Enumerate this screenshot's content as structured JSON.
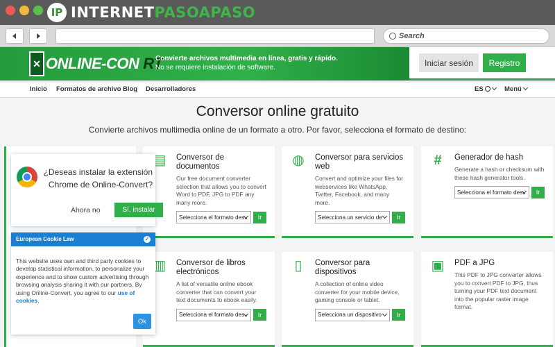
{
  "browser": {
    "brand_prefix": "INTERNET",
    "brand_accent": "PASOAPASO",
    "brand_logo_letter": "IP",
    "back_icon": "back-arrow-icon",
    "forward_icon": "forward-arrow-icon",
    "search_placeholder": "Search",
    "colors": {
      "titlebar": "#5a5a5a",
      "accent": "#3fb54a"
    }
  },
  "header": {
    "logo_main": "ONLINE-CON",
    "logo_accent": "RT",
    "tagline_line1": "Convierte archivos multimedia en línea, gratis y rápido.",
    "tagline_line2": "No se requiere instalación de software.",
    "login_label": "Iniciar sesión",
    "register_label": "Registro",
    "colors": {
      "brand_green": "#2fae49"
    }
  },
  "nav": {
    "items": [
      "Inicio",
      "Formatos de archivo",
      "Blog",
      "Desarrolladores"
    ],
    "language": "ES",
    "menu_label": "Menú"
  },
  "main": {
    "title": "Conversor online gratuito",
    "subtitle": "Convierte archivos multimedia online de un formato a otro. Por favor, selecciona el formato de destino:",
    "cards": [
      {
        "icon": "document-icon",
        "title": "Conversor de documentos",
        "description": "Our free document converter selection that allows you to convert Word to PDF, JPG to PDF any many more.",
        "select_value": "Selecciona el formato desti",
        "button_label": "Ir"
      },
      {
        "icon": "globe-icon",
        "title": "Conversor para servicios web",
        "description": "Convert and optimize your files for webservices like WhatsApp, Twitter, Facebook, and many more.",
        "select_value": "Selecciona un servicio de",
        "button_label": "Ir"
      },
      {
        "icon": "hash-icon",
        "title": "Generador de hash",
        "description": "Generate a hash or checksum with these hash generator tools.",
        "select_value": "Selecciona el formato desti",
        "button_label": "Ir"
      },
      {
        "icon": "book-icon",
        "title": "Conversor de libros electrónicos",
        "description": "A list of versatile online ebook converter that can convert your text documents to ebook easily.",
        "select_value": "Selecciona el formato desti",
        "button_label": "Ir"
      },
      {
        "icon": "tablet-icon",
        "title": "Conversor para dispositivos",
        "description": "A collection of online video converter for your mobile device, gaming console or tablet.",
        "select_value": "Selecciona un dispositivo",
        "button_label": "Ir"
      },
      {
        "icon": "image-icon",
        "title": "PDF a JPG",
        "description": "This PDF to JPG converter allows you to convert PDF to JPG, thus turning your PDF text document into the popular raster image format.",
        "select_value": "",
        "button_label": ""
      }
    ]
  },
  "chrome_prompt": {
    "question": "¿Deseas instalar la extensión Chrome de Online-Convert?",
    "decline_label": "Ahora no",
    "accept_label": "Sí, instalar"
  },
  "cookie_notice": {
    "heading": "European Cookie Law",
    "body": "This website uses own and third party cookies to develop statistical information, to personalize your experience and to show custom advertising through browsing analysis sharing it with our partners. By using Online-Convert, you agree to our",
    "link_text": "use of cookies",
    "link_suffix": ".",
    "ok_label": "Ok"
  }
}
